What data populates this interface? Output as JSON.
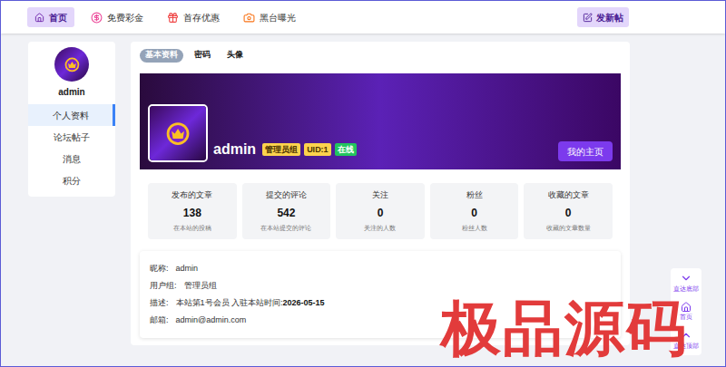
{
  "nav": {
    "items": [
      {
        "label": "首页",
        "selected": true
      },
      {
        "label": "免费彩金",
        "selected": false
      },
      {
        "label": "首存优惠",
        "selected": false
      },
      {
        "label": "黑台曝光",
        "selected": false
      }
    ],
    "post_button": "发新帖"
  },
  "sidebar": {
    "username": "admin",
    "items": [
      {
        "label": "个人资料",
        "selected": true
      },
      {
        "label": "论坛帖子",
        "selected": false
      },
      {
        "label": "消息",
        "selected": false
      },
      {
        "label": "积分",
        "selected": false
      }
    ]
  },
  "tabs": [
    {
      "label": "基本资料",
      "selected": true
    },
    {
      "label": "密码",
      "selected": false
    },
    {
      "label": "头像",
      "selected": false
    }
  ],
  "profile": {
    "name": "admin",
    "badges": [
      {
        "label": "管理员组",
        "color": "#fcd34d"
      },
      {
        "label": "UID:1",
        "color": "#fcd34d"
      },
      {
        "label": "在线",
        "color": "#22c55e"
      }
    ],
    "home_button": "我的主页"
  },
  "stats": [
    {
      "title": "发布的文章",
      "value": "138",
      "caption": "在本站的投稿"
    },
    {
      "title": "提交的评论",
      "value": "542",
      "caption": "在本站提交的评论"
    },
    {
      "title": "关注",
      "value": "0",
      "caption": "关注的人数"
    },
    {
      "title": "粉丝",
      "value": "0",
      "caption": "粉丝人数"
    },
    {
      "title": "收藏的文章",
      "value": "0",
      "caption": "收藏的文章数量"
    }
  ],
  "info": [
    {
      "label": "昵称:",
      "value": "admin",
      "strong": ""
    },
    {
      "label": "用户组:",
      "value": "管理员组",
      "strong": ""
    },
    {
      "label": "描述:",
      "value": "本站第1号会员 入驻本站时间:",
      "strong": "2026-05-15"
    },
    {
      "label": "邮箱:",
      "value": "admin@admin.com",
      "strong": ""
    }
  ],
  "float_buttons": [
    "直达底部",
    "首页",
    "直达顶部"
  ],
  "watermark": "极品源码"
}
